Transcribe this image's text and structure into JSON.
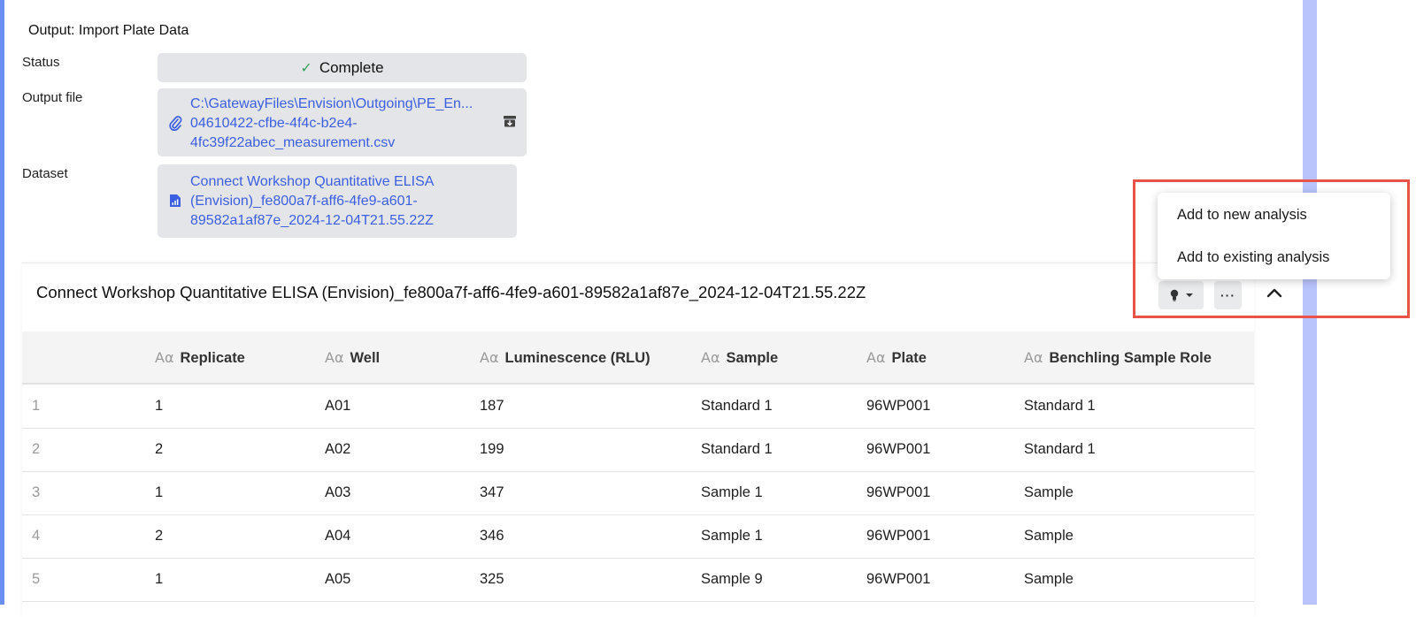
{
  "output": {
    "title": "Output: Import Plate Data",
    "status_label": "Status",
    "status_value": "Complete",
    "file_label": "Output file",
    "file_lines": [
      "C:\\GatewayFiles\\Envision\\Outgoing\\PE_En...",
      "04610422-cfbe-4f4c-b2e4-",
      "4fc39f22abec_measurement.csv"
    ],
    "dataset_label": "Dataset",
    "dataset_lines": [
      "Connect Workshop Quantitative ELISA",
      "(Envision)_fe800a7f-aff6-4fe9-a601-",
      "89582a1af87e_2024-12-04T21.55.22Z"
    ]
  },
  "card": {
    "title": "Connect Workshop Quantitative ELISA (Envision)_fe800a7f-aff6-4fe9-a601-89582a1af87e_2024-12-04T21.55.22Z",
    "more_label": "···"
  },
  "menu": {
    "items": [
      "Add to new analysis",
      "Add to existing analysis"
    ]
  },
  "table": {
    "type_glyph": "Aα",
    "columns": [
      "Replicate",
      "Well",
      "Luminescence (RLU)",
      "Sample",
      "Plate",
      "Benchling Sample Role"
    ],
    "rows": [
      [
        "1",
        "1",
        "A01",
        "187",
        "Standard 1",
        "96WP001",
        "Standard 1"
      ],
      [
        "2",
        "2",
        "A02",
        "199",
        "Standard 1",
        "96WP001",
        "Standard 1"
      ],
      [
        "3",
        "1",
        "A03",
        "347",
        "Sample 1",
        "96WP001",
        "Sample"
      ],
      [
        "4",
        "2",
        "A04",
        "346",
        "Sample 1",
        "96WP001",
        "Sample"
      ],
      [
        "5",
        "1",
        "A05",
        "325",
        "Sample 9",
        "96WP001",
        "Sample"
      ]
    ]
  },
  "colors": {
    "link": "#3b5fe0",
    "highlight": "#e8534a",
    "accent_band": "#b8c4fb",
    "check": "#3aa05a"
  },
  "icons": [
    "check-icon",
    "paperclip-icon",
    "archive-icon",
    "dataset-file-icon",
    "lightbulb-icon",
    "caret-down-icon",
    "more-icon",
    "chevron-up-icon"
  ]
}
